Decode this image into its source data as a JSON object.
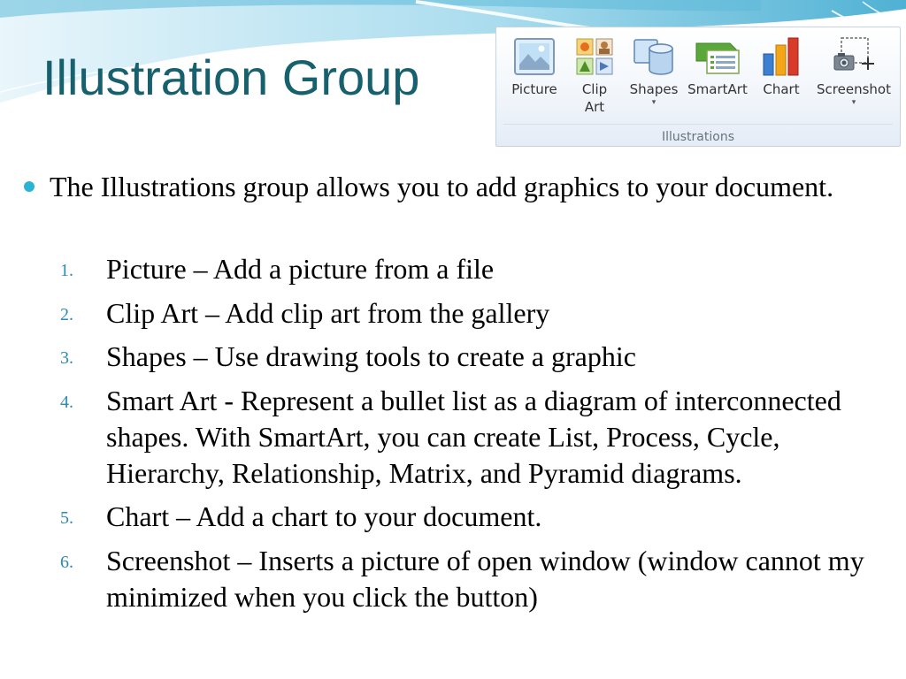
{
  "slide": {
    "title": "Illustration Group",
    "main_bullet": "The Illustrations group allows you to add graphics to your document.",
    "steps": [
      {
        "num": "1.",
        "text": "Picture – Add a picture from a file"
      },
      {
        "num": "2.",
        "text": "Clip Art – Add clip art from the gallery"
      },
      {
        "num": "3.",
        "text": "Shapes – Use drawing tools to create a graphic"
      },
      {
        "num": "4.",
        "text": "Smart Art - Represent a bullet list as a diagram of interconnected shapes. With SmartArt, you can create List, Process, Cycle, Hierarchy, Relationship, Matrix, and Pyramid diagrams."
      },
      {
        "num": "5.",
        "text": "Chart – Add a chart to your document."
      },
      {
        "num": "6.",
        "text": "Screenshot – Inserts a picture of open window (window cannot my minimized when you click the button)"
      }
    ]
  },
  "ribbon": {
    "group_label": "Illustrations",
    "buttons": [
      {
        "label": "Picture",
        "icon": "picture-icon"
      },
      {
        "label_line1": "Clip",
        "label_line2": "Art",
        "icon": "clip-art-icon"
      },
      {
        "label": "Shapes",
        "icon": "shapes-icon",
        "dropdown": "▾"
      },
      {
        "label": "SmartArt",
        "icon": "smartart-icon"
      },
      {
        "label": "Chart",
        "icon": "chart-icon"
      },
      {
        "label": "Screenshot",
        "icon": "screenshot-icon",
        "dropdown": "▾"
      }
    ]
  },
  "colors": {
    "title": "#17606e",
    "bullet": "#2bb3d3",
    "step_numbers": "#2b8bb0",
    "header_wave": "#5ab7d6"
  }
}
